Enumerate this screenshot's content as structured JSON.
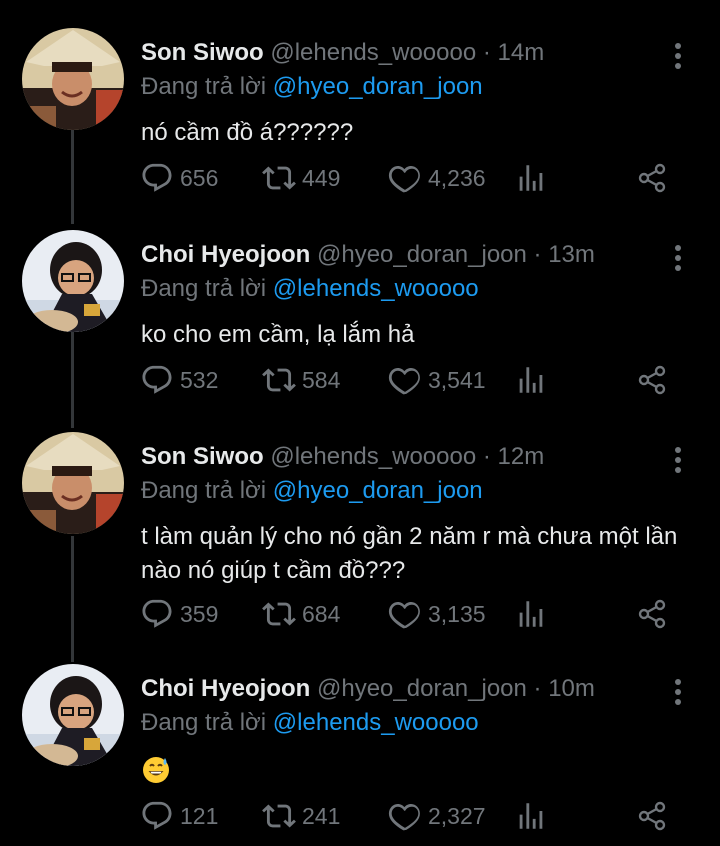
{
  "tweets": [
    {
      "name": "Son Siwoo",
      "handle": "@lehends_wooooo",
      "dot": "·",
      "time": "14m",
      "replying_prefix": "Đang trả lời",
      "replying_to": "@hyeo_doran_joon",
      "text": "nó cầm đồ á??????",
      "replies": "656",
      "retweets": "449",
      "likes": "4,236",
      "avatar_icon": "avatar-son-siwoo"
    },
    {
      "name": "Choi Hyeojoon",
      "handle": "@hyeo_doran_joon",
      "dot": "·",
      "time": "13m",
      "replying_prefix": "Đang trả lời",
      "replying_to": "@lehends_wooooo",
      "text": "ko cho em cầm, lạ lắm hả",
      "replies": "532",
      "retweets": "584",
      "likes": "3,541",
      "avatar_icon": "avatar-choi-hyeojoon"
    },
    {
      "name": "Son Siwoo",
      "handle": "@lehends_wooooo",
      "dot": "·",
      "time": "12m",
      "replying_prefix": "Đang trả lời",
      "replying_to": "@hyeo_doran_joon",
      "text": "t làm quản lý cho nó gần 2 năm r mà chưa một lần nào nó giúp t cầm đồ???",
      "replies": "359",
      "retweets": "684",
      "likes": "3,135",
      "avatar_icon": "avatar-son-siwoo"
    },
    {
      "name": "Choi Hyeojoon",
      "handle": "@hyeo_doran_joon",
      "dot": "·",
      "time": "10m",
      "replying_prefix": "Đang trả lời",
      "replying_to": "@lehends_wooooo",
      "text": "",
      "emoji": "grinning-face-with-sweat",
      "replies": "121",
      "retweets": "241",
      "likes": "2,327",
      "avatar_icon": "avatar-choi-hyeojoon"
    }
  ],
  "icons": {
    "reply": "reply-icon",
    "retweet": "retweet-icon",
    "like": "heart-icon",
    "analytics": "analytics-icon",
    "share": "share-icon",
    "more": "more-vertical-icon"
  },
  "colors": {
    "background": "#000000",
    "text": "#e7e9ea",
    "secondary": "#71767b",
    "accent": "#1d9bf0",
    "thread_line": "#333639"
  }
}
